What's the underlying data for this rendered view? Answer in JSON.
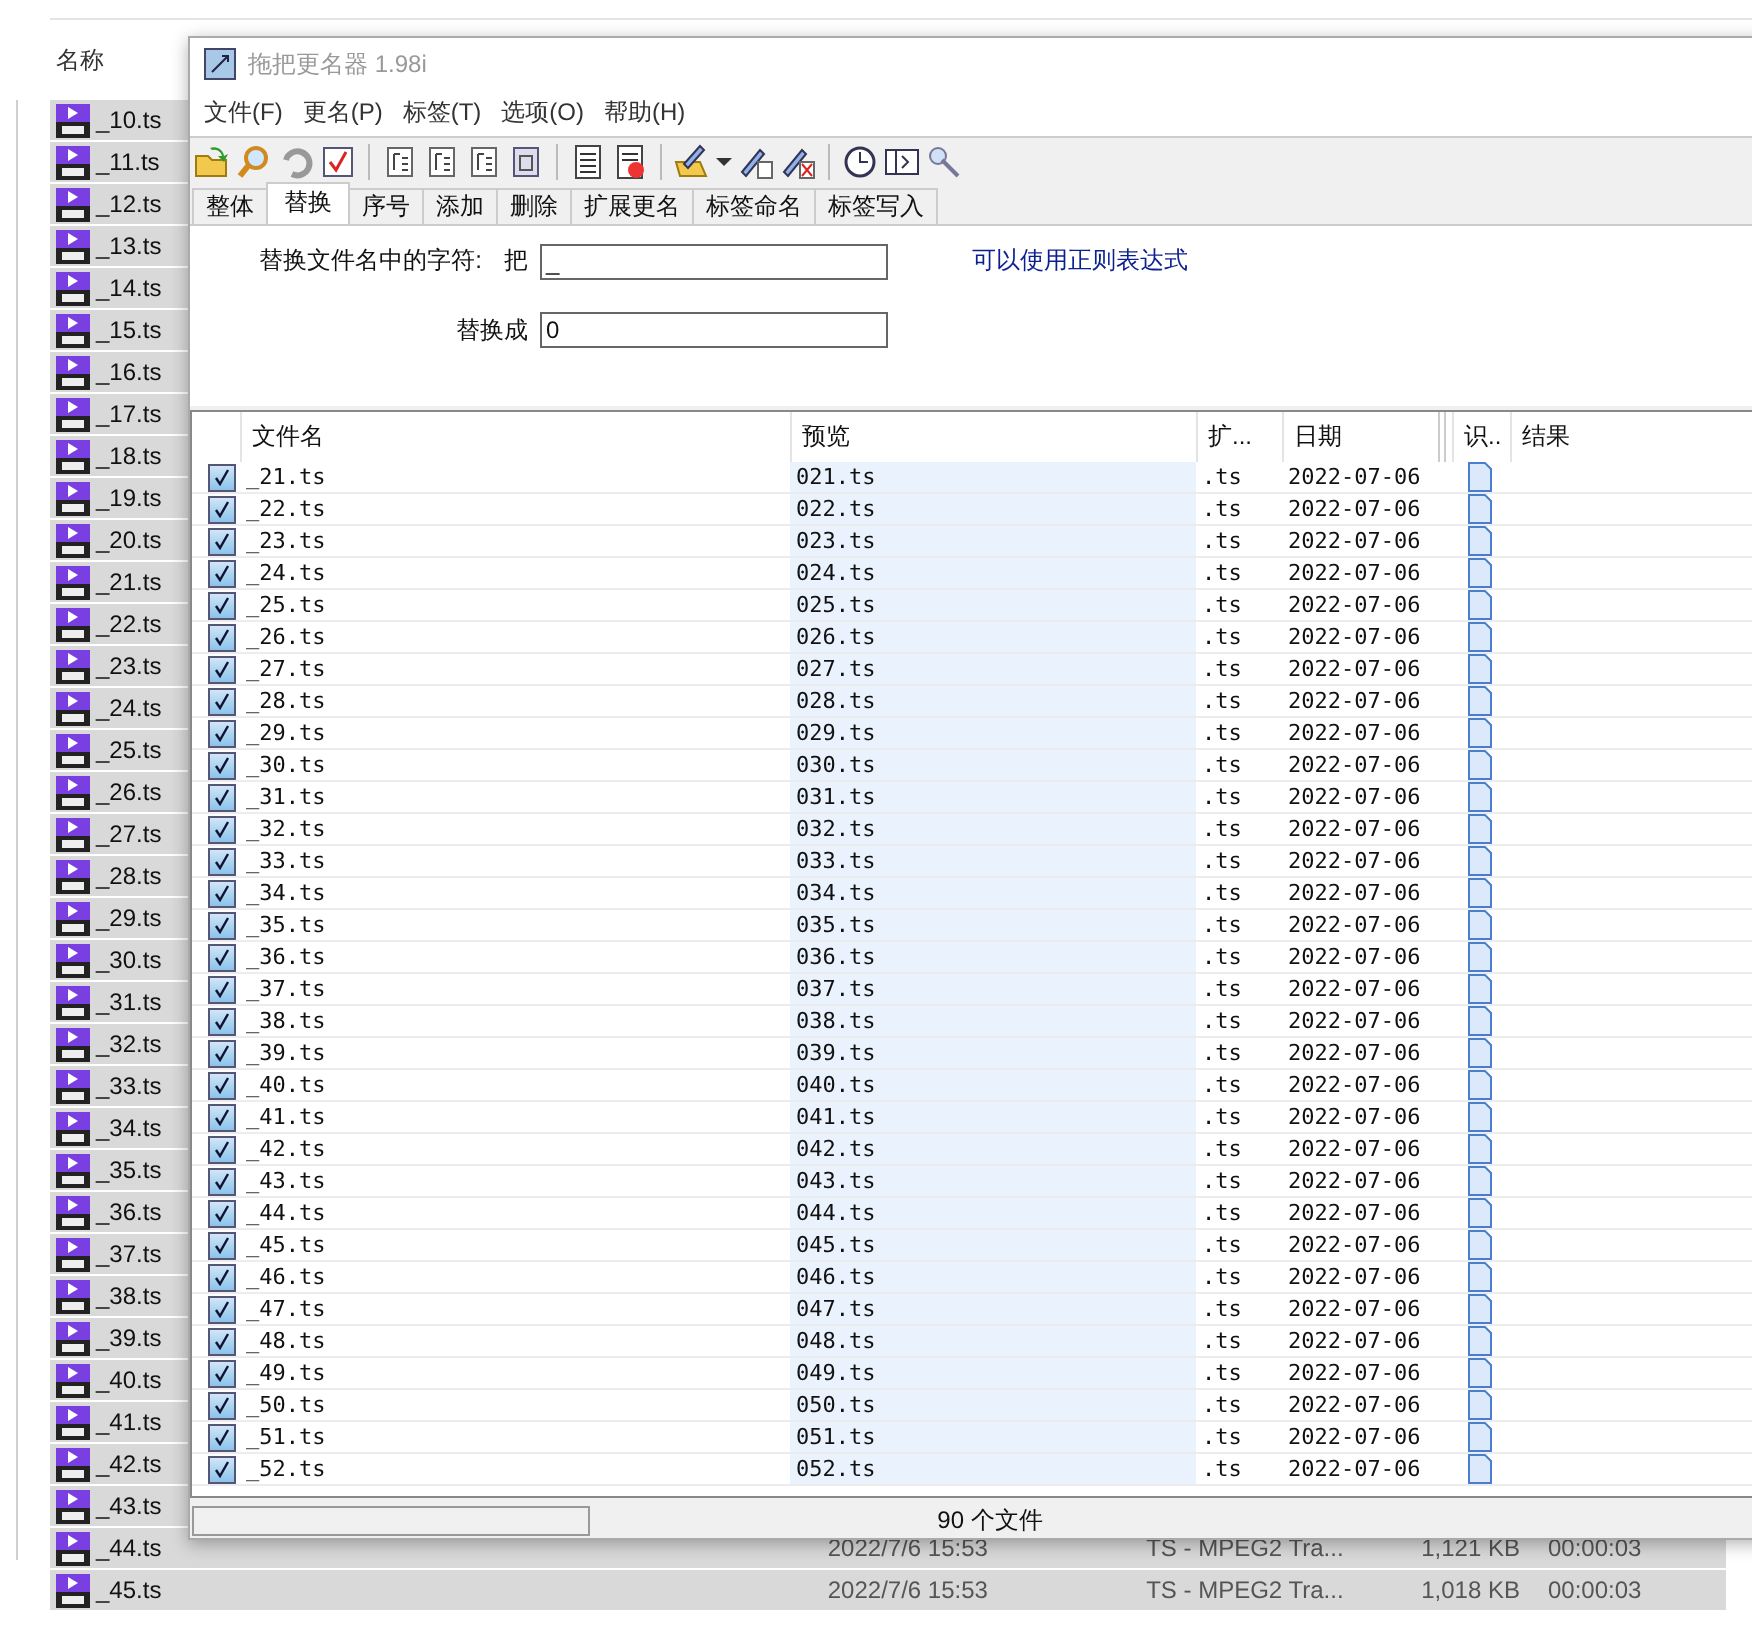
{
  "explorer": {
    "column_1": "名称",
    "files": [
      {
        "name": "_10.ts",
        "selected": true
      },
      {
        "name": "_11.ts",
        "selected": true
      },
      {
        "name": "_12.ts",
        "selected": true
      },
      {
        "name": "_13.ts",
        "selected": true
      },
      {
        "name": "_14.ts",
        "selected": true
      },
      {
        "name": "_15.ts",
        "selected": true
      },
      {
        "name": "_16.ts",
        "selected": true
      },
      {
        "name": "_17.ts",
        "selected": true
      },
      {
        "name": "_18.ts",
        "selected": true
      },
      {
        "name": "_19.ts",
        "selected": true
      },
      {
        "name": "_20.ts",
        "selected": true
      },
      {
        "name": "_21.ts",
        "selected": true
      },
      {
        "name": "_22.ts",
        "selected": true
      },
      {
        "name": "_23.ts",
        "selected": true
      },
      {
        "name": "_24.ts",
        "selected": true
      },
      {
        "name": "_25.ts",
        "selected": true
      },
      {
        "name": "_26.ts",
        "selected": true
      },
      {
        "name": "_27.ts",
        "selected": true
      },
      {
        "name": "_28.ts",
        "selected": true
      },
      {
        "name": "_29.ts",
        "selected": true
      },
      {
        "name": "_30.ts",
        "selected": true
      },
      {
        "name": "_31.ts",
        "selected": true
      },
      {
        "name": "_32.ts",
        "selected": true
      },
      {
        "name": "_33.ts",
        "selected": true
      },
      {
        "name": "_34.ts",
        "selected": true
      },
      {
        "name": "_35.ts",
        "selected": true
      },
      {
        "name": "_36.ts",
        "selected": true
      },
      {
        "name": "_37.ts",
        "selected": true
      },
      {
        "name": "_38.ts",
        "selected": true
      },
      {
        "name": "_39.ts",
        "selected": true
      },
      {
        "name": "_40.ts",
        "selected": true
      },
      {
        "name": "_41.ts",
        "selected": true
      },
      {
        "name": "_42.ts",
        "selected": true
      },
      {
        "name": "_43.ts",
        "selected": true
      },
      {
        "name": "_44.ts",
        "selected": true,
        "date": "2022/7/6 15:53",
        "type": "TS - MPEG2 Tra...",
        "size": "1,121 KB",
        "duration": "00:00:03"
      },
      {
        "name": "_45.ts",
        "selected": true,
        "date": "2022/7/6 15:53",
        "type": "TS - MPEG2 Tra...",
        "size": "1,018 KB",
        "duration": "00:00:03"
      }
    ]
  },
  "dialog": {
    "title": "拖把更名器 1.98i",
    "menu": [
      "文件(F)",
      "更名(P)",
      "标签(T)",
      "选项(O)",
      "帮助(H)"
    ],
    "tabs": [
      {
        "label": "整体",
        "selected": false
      },
      {
        "label": "替换",
        "selected": true
      },
      {
        "label": "序号",
        "selected": false
      },
      {
        "label": "添加",
        "selected": false
      },
      {
        "label": "删除",
        "selected": false
      },
      {
        "label": "扩展更名",
        "selected": false
      },
      {
        "label": "标签命名",
        "selected": false
      },
      {
        "label": "标签写入",
        "selected": false
      }
    ],
    "replace": {
      "label": "替换文件名中的字符:",
      "from_label": "把",
      "from_value": "_",
      "to_label": "替换成",
      "to_value": "0",
      "hint": "可以使用正则表达式"
    },
    "table": {
      "columns": [
        "文件名",
        "预览",
        "扩...",
        "日期",
        "识..",
        "结果"
      ],
      "rows": [
        {
          "checked": true,
          "name": "_21.ts",
          "preview": "021.ts",
          "ext": ".ts",
          "date": "2022-07-06"
        },
        {
          "checked": true,
          "name": "_22.ts",
          "preview": "022.ts",
          "ext": ".ts",
          "date": "2022-07-06"
        },
        {
          "checked": true,
          "name": "_23.ts",
          "preview": "023.ts",
          "ext": ".ts",
          "date": "2022-07-06"
        },
        {
          "checked": true,
          "name": "_24.ts",
          "preview": "024.ts",
          "ext": ".ts",
          "date": "2022-07-06"
        },
        {
          "checked": true,
          "name": "_25.ts",
          "preview": "025.ts",
          "ext": ".ts",
          "date": "2022-07-06"
        },
        {
          "checked": true,
          "name": "_26.ts",
          "preview": "026.ts",
          "ext": ".ts",
          "date": "2022-07-06"
        },
        {
          "checked": true,
          "name": "_27.ts",
          "preview": "027.ts",
          "ext": ".ts",
          "date": "2022-07-06"
        },
        {
          "checked": true,
          "name": "_28.ts",
          "preview": "028.ts",
          "ext": ".ts",
          "date": "2022-07-06"
        },
        {
          "checked": true,
          "name": "_29.ts",
          "preview": "029.ts",
          "ext": ".ts",
          "date": "2022-07-06"
        },
        {
          "checked": true,
          "name": "_30.ts",
          "preview": "030.ts",
          "ext": ".ts",
          "date": "2022-07-06"
        },
        {
          "checked": true,
          "name": "_31.ts",
          "preview": "031.ts",
          "ext": ".ts",
          "date": "2022-07-06"
        },
        {
          "checked": true,
          "name": "_32.ts",
          "preview": "032.ts",
          "ext": ".ts",
          "date": "2022-07-06"
        },
        {
          "checked": true,
          "name": "_33.ts",
          "preview": "033.ts",
          "ext": ".ts",
          "date": "2022-07-06"
        },
        {
          "checked": true,
          "name": "_34.ts",
          "preview": "034.ts",
          "ext": ".ts",
          "date": "2022-07-06"
        },
        {
          "checked": true,
          "name": "_35.ts",
          "preview": "035.ts",
          "ext": ".ts",
          "date": "2022-07-06"
        },
        {
          "checked": true,
          "name": "_36.ts",
          "preview": "036.ts",
          "ext": ".ts",
          "date": "2022-07-06"
        },
        {
          "checked": true,
          "name": "_37.ts",
          "preview": "037.ts",
          "ext": ".ts",
          "date": "2022-07-06"
        },
        {
          "checked": true,
          "name": "_38.ts",
          "preview": "038.ts",
          "ext": ".ts",
          "date": "2022-07-06"
        },
        {
          "checked": true,
          "name": "_39.ts",
          "preview": "039.ts",
          "ext": ".ts",
          "date": "2022-07-06"
        },
        {
          "checked": true,
          "name": "_40.ts",
          "preview": "040.ts",
          "ext": ".ts",
          "date": "2022-07-06"
        },
        {
          "checked": true,
          "name": "_41.ts",
          "preview": "041.ts",
          "ext": ".ts",
          "date": "2022-07-06"
        },
        {
          "checked": true,
          "name": "_42.ts",
          "preview": "042.ts",
          "ext": ".ts",
          "date": "2022-07-06"
        },
        {
          "checked": true,
          "name": "_43.ts",
          "preview": "043.ts",
          "ext": ".ts",
          "date": "2022-07-06"
        },
        {
          "checked": true,
          "name": "_44.ts",
          "preview": "044.ts",
          "ext": ".ts",
          "date": "2022-07-06"
        },
        {
          "checked": true,
          "name": "_45.ts",
          "preview": "045.ts",
          "ext": ".ts",
          "date": "2022-07-06"
        },
        {
          "checked": true,
          "name": "_46.ts",
          "preview": "046.ts",
          "ext": ".ts",
          "date": "2022-07-06"
        },
        {
          "checked": true,
          "name": "_47.ts",
          "preview": "047.ts",
          "ext": ".ts",
          "date": "2022-07-06"
        },
        {
          "checked": true,
          "name": "_48.ts",
          "preview": "048.ts",
          "ext": ".ts",
          "date": "2022-07-06"
        },
        {
          "checked": true,
          "name": "_49.ts",
          "preview": "049.ts",
          "ext": ".ts",
          "date": "2022-07-06"
        },
        {
          "checked": true,
          "name": "_50.ts",
          "preview": "050.ts",
          "ext": ".ts",
          "date": "2022-07-06"
        },
        {
          "checked": true,
          "name": "_51.ts",
          "preview": "051.ts",
          "ext": ".ts",
          "date": "2022-07-06"
        },
        {
          "checked": true,
          "name": "_52.ts",
          "preview": "052.ts",
          "ext": ".ts",
          "date": "2022-07-06"
        }
      ]
    },
    "progress": {
      "level": 0
    },
    "status": "90 个文件"
  }
}
